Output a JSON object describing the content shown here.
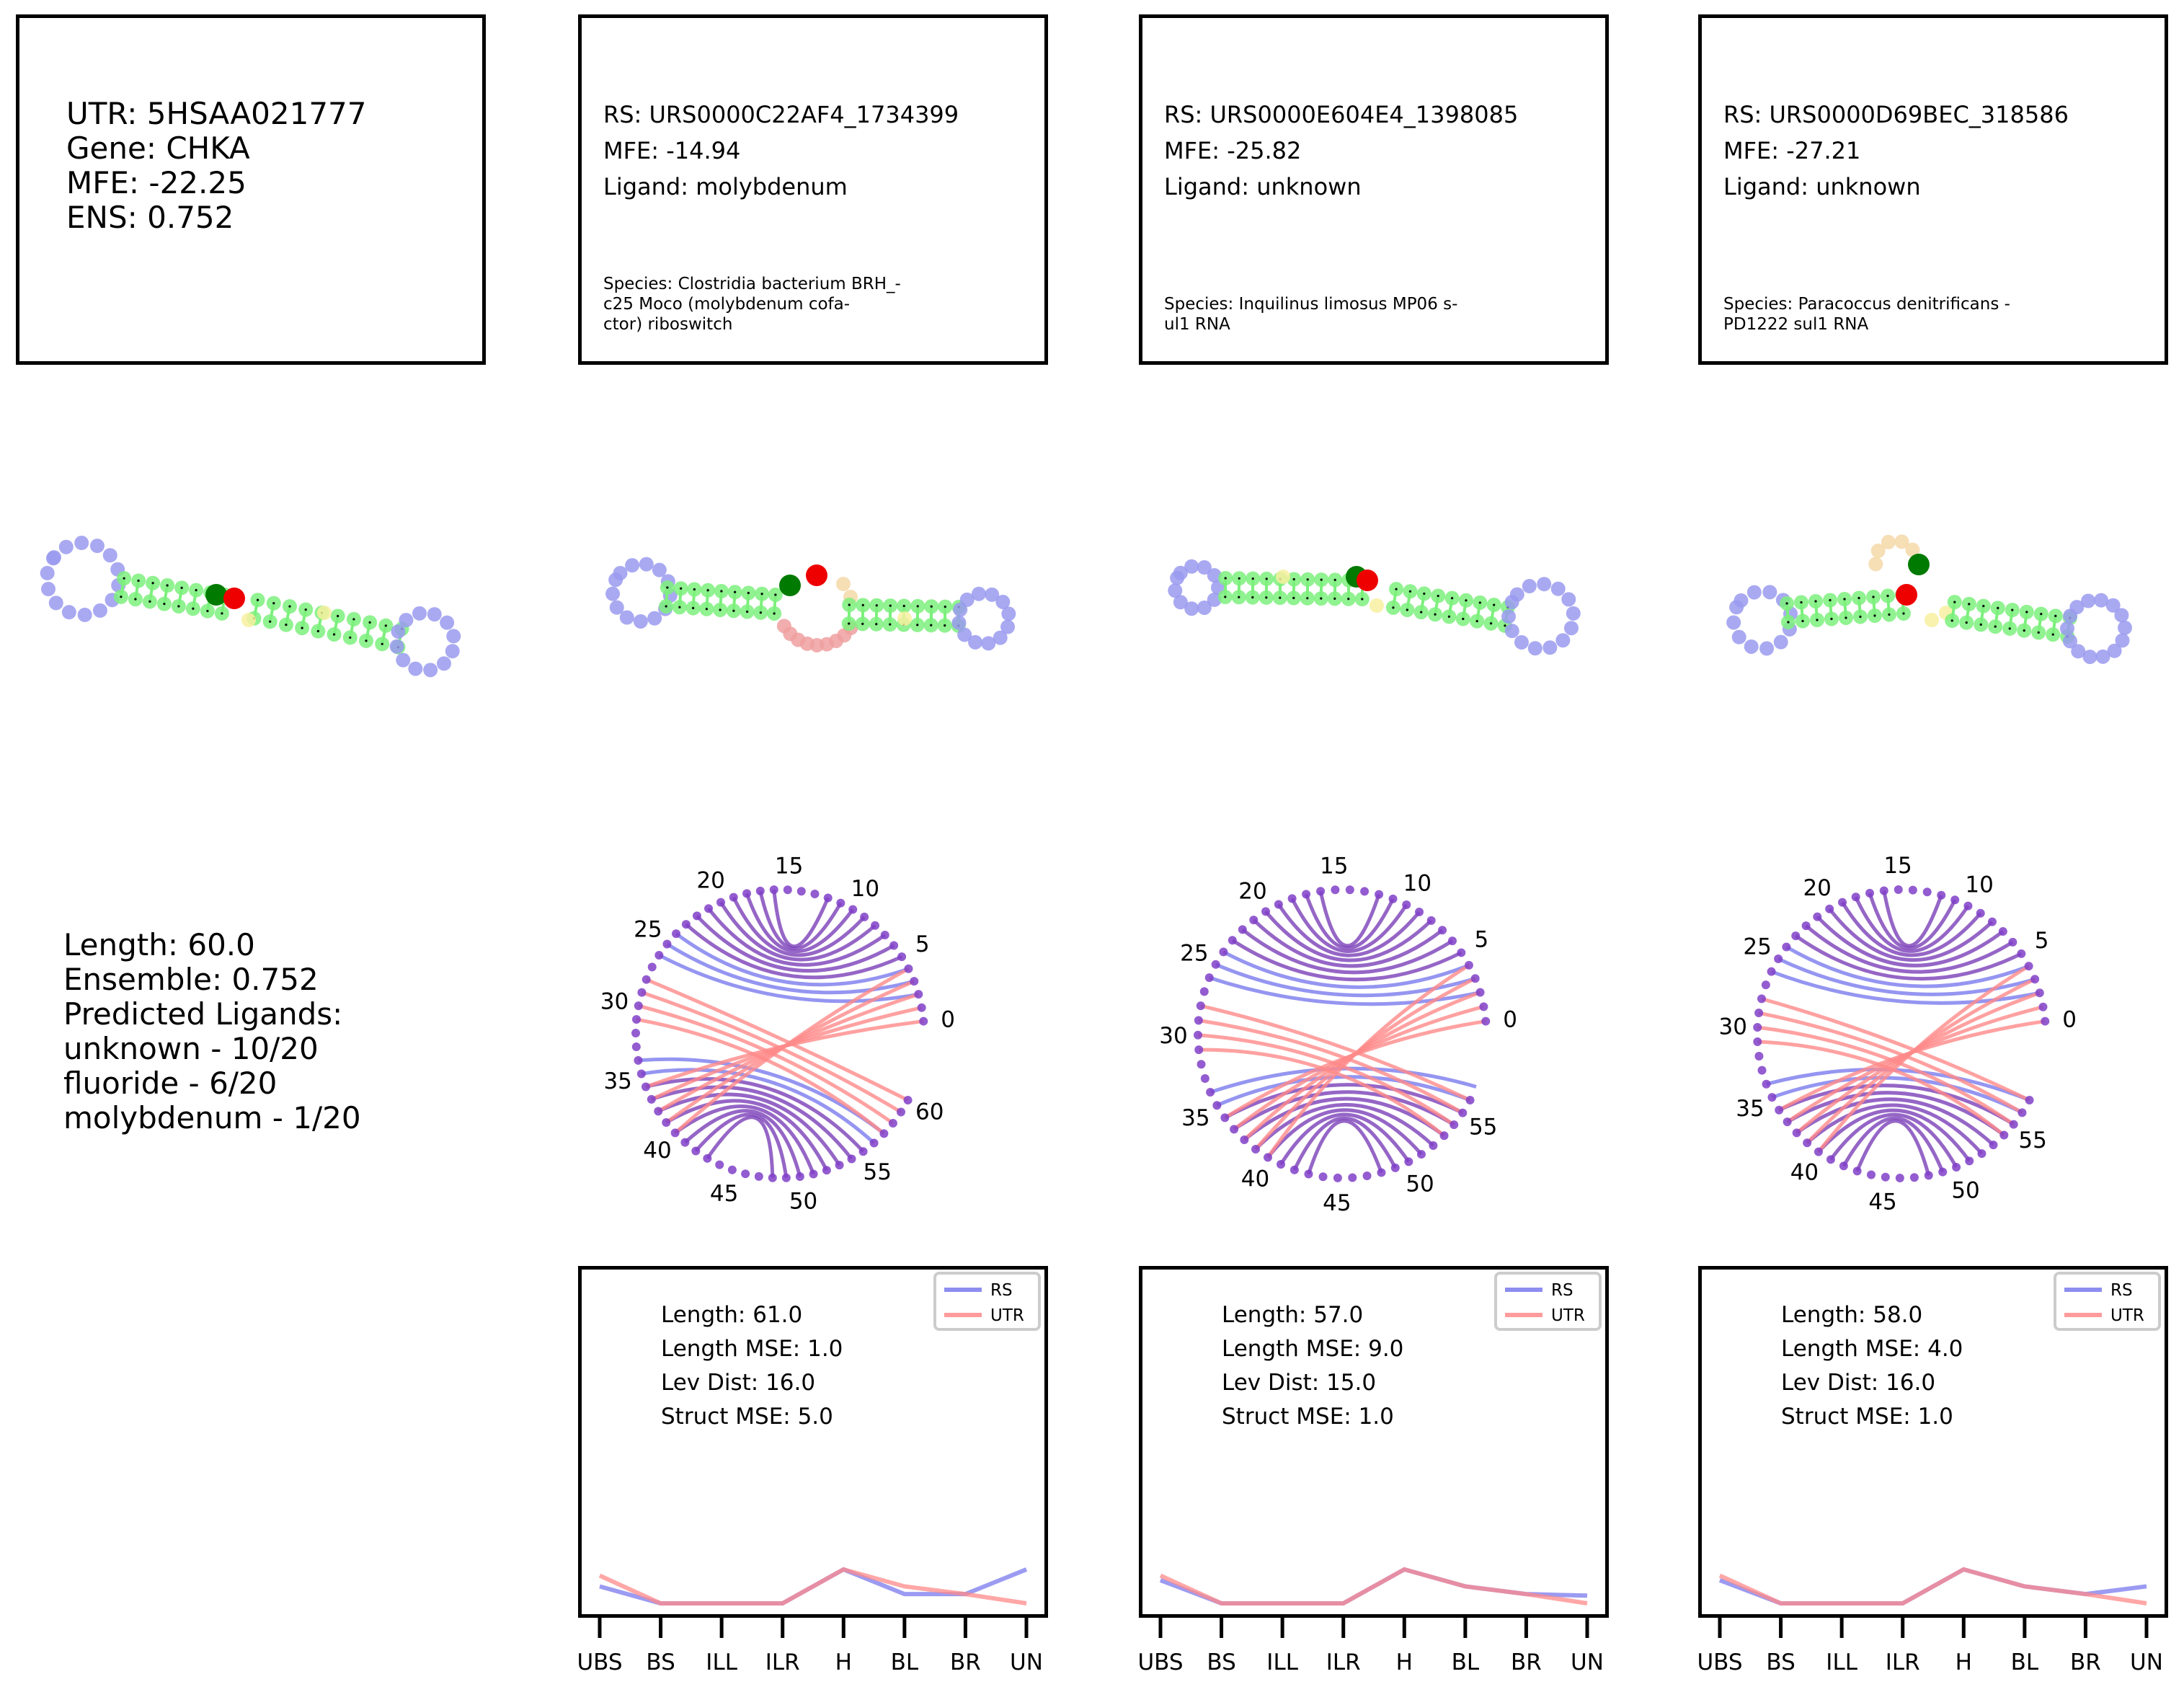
{
  "utr_card": {
    "lines": [
      "UTR: 5HSAA021777",
      "Gene: CHKA",
      "MFE: -22.25",
      "ENS: 0.752"
    ]
  },
  "utr_stats": {
    "lines": [
      "Length: 60.0",
      "Ensemble: 0.752",
      "Predicted Ligands:",
      "unknown - 10/20",
      "fluoride - 6/20",
      "molybdenum - 1/20"
    ]
  },
  "rs_cards": [
    {
      "lines": [
        "RS: URS0000C22AF4_1734399",
        "MFE: -14.94",
        "Ligand: molybdenum"
      ],
      "species": [
        "Species: Clostridia bacterium BRH_-",
        "c25 Moco (molybdenum cofa-",
        "ctor) riboswitch"
      ]
    },
    {
      "lines": [
        "RS: URS0000E604E4_1398085",
        "MFE: -25.82",
        "Ligand: unknown"
      ],
      "species": [
        "Species: Inquilinus limosus MP06 s-",
        "ul1 RNA"
      ]
    },
    {
      "lines": [
        "RS: URS0000D69BEC_318586",
        "MFE: -27.21",
        "Ligand: unknown"
      ],
      "species": [
        "Species: Paracoccus denitrificans -",
        "PD1222 sul1 RNA"
      ]
    }
  ],
  "colors": {
    "loop": "#9a9af0",
    "stem": "#7cf07c",
    "bulge": "#f7f0a0",
    "interior": "#f0a0a0",
    "hairpin_extra": "#f5d8a8",
    "green_marker": "#007a00",
    "red_marker": "#ee0000",
    "rs_arc": "#7a7aee",
    "utr_arc": "#ff8a8a",
    "shared_arc": "#7a40b8",
    "node": "#8040c8"
  },
  "arc_tick_labels": [
    [
      "0",
      "5",
      "10",
      "15",
      "20",
      "25",
      "30",
      "35",
      "40",
      "45",
      "50",
      "55",
      "60"
    ],
    [
      "0",
      "5",
      "10",
      "15",
      "20",
      "25",
      "30",
      "35",
      "40",
      "45",
      "50",
      "55"
    ],
    [
      "0",
      "5",
      "10",
      "15",
      "20",
      "25",
      "30",
      "35",
      "40",
      "45",
      "50",
      "55"
    ]
  ],
  "chart_data": [
    {
      "type": "line",
      "categories": [
        "UBS",
        "BS",
        "ILL",
        "ILR",
        "H",
        "BL",
        "BR",
        "UN"
      ],
      "series": [
        {
          "name": "RS",
          "values": [
            1.1,
            0.0,
            0.0,
            0.0,
            2.2,
            0.6,
            0.6,
            2.2
          ]
        },
        {
          "name": "UTR",
          "values": [
            1.8,
            0.0,
            0.0,
            0.0,
            2.2,
            1.1,
            0.6,
            0.0
          ]
        }
      ],
      "ylim": [
        0,
        20
      ],
      "legend": "top-right",
      "annotations": [
        "Length: 61.0",
        "Length MSE: 1.0",
        "Lev Dist: 16.0",
        "Struct MSE: 5.0"
      ]
    },
    {
      "type": "line",
      "categories": [
        "UBS",
        "BS",
        "ILL",
        "ILR",
        "H",
        "BL",
        "BR",
        "UN"
      ],
      "series": [
        {
          "name": "RS",
          "values": [
            1.5,
            0.0,
            0.0,
            0.0,
            2.2,
            1.1,
            0.6,
            0.5
          ]
        },
        {
          "name": "UTR",
          "values": [
            1.8,
            0.0,
            0.0,
            0.0,
            2.2,
            1.1,
            0.6,
            0.0
          ]
        }
      ],
      "ylim": [
        0,
        20
      ],
      "legend": "top-right",
      "annotations": [
        "Length: 57.0",
        "Length MSE: 9.0",
        "Lev Dist: 15.0",
        "Struct MSE: 1.0"
      ]
    },
    {
      "type": "line",
      "categories": [
        "UBS",
        "BS",
        "ILL",
        "ILR",
        "H",
        "BL",
        "BR",
        "UN"
      ],
      "series": [
        {
          "name": "RS",
          "values": [
            1.5,
            0.0,
            0.0,
            0.0,
            2.2,
            1.1,
            0.6,
            1.1
          ]
        },
        {
          "name": "UTR",
          "values": [
            1.8,
            0.0,
            0.0,
            0.0,
            2.2,
            1.1,
            0.6,
            0.0
          ]
        }
      ],
      "ylim": [
        0,
        20
      ],
      "legend": "top-right",
      "annotations": [
        "Length: 58.0",
        "Length MSE: 4.0",
        "Lev Dist: 16.0",
        "Struct MSE: 1.0"
      ]
    }
  ]
}
